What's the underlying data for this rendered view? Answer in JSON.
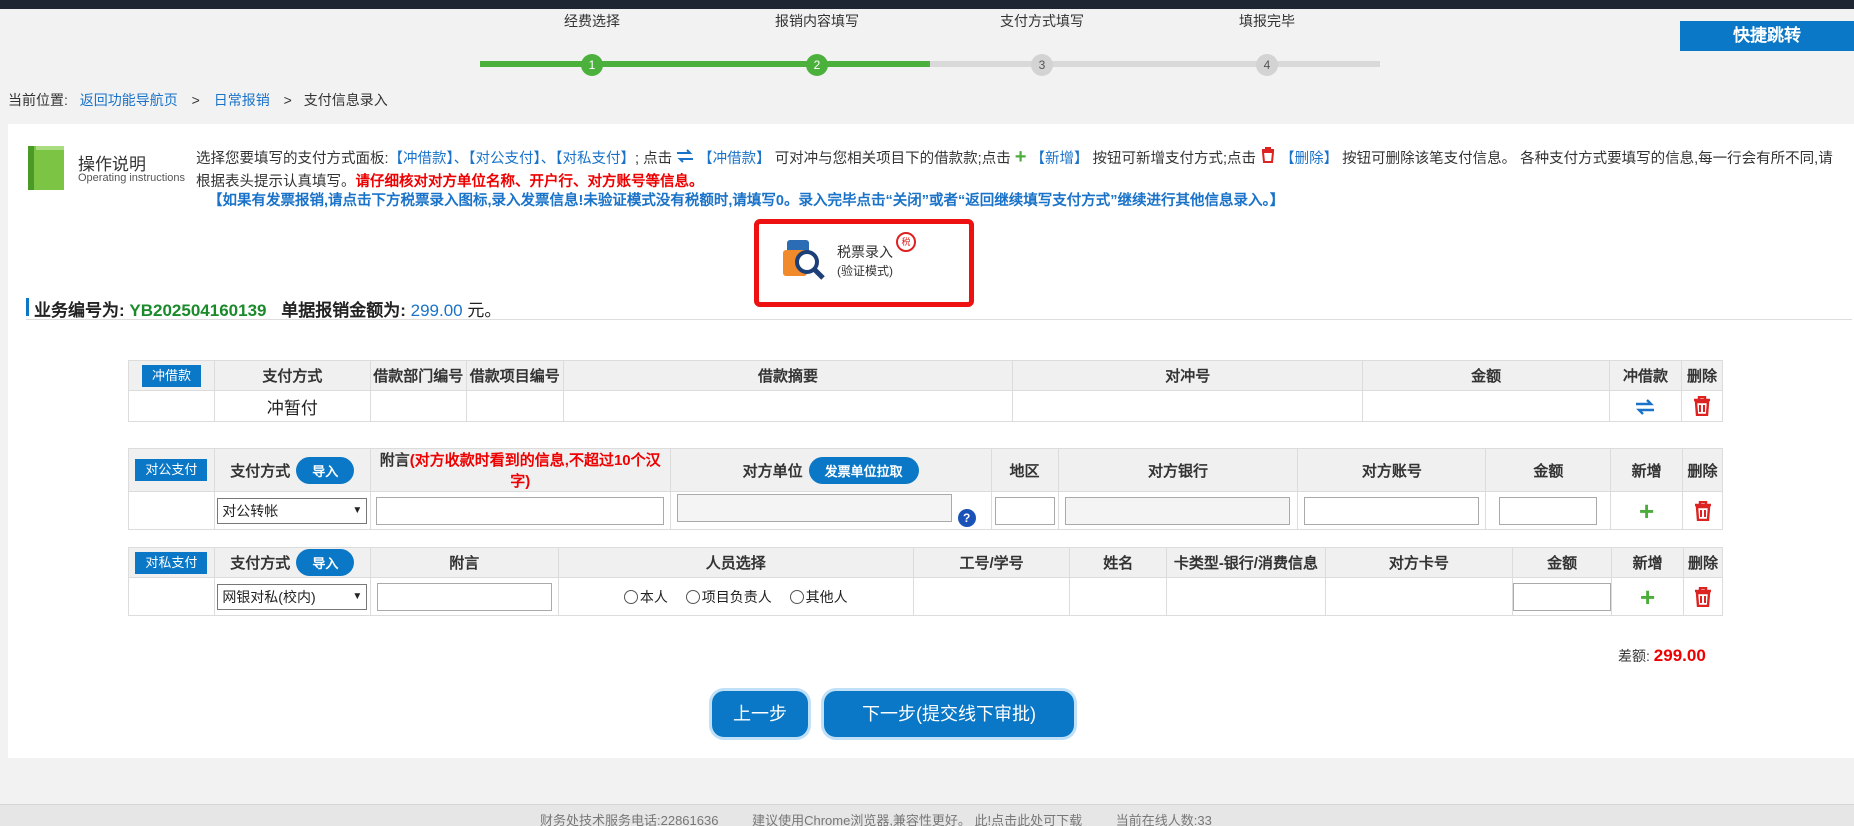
{
  "steps": [
    "经费选择",
    "报销内容填写",
    "支付方式填写",
    "填报完毕"
  ],
  "step_numbers": [
    "1",
    "2",
    "3",
    "4"
  ],
  "quick_jump": "快捷跳转",
  "breadcrumb": {
    "prefix": "当前位置:",
    "home": "返回功能导航页",
    "daily": "日常报销",
    "sep": ">",
    "current": "支付信息录入"
  },
  "instructions": {
    "title": "操作说明",
    "subtitle": "Operating instructions",
    "p1": "选择您要填写的支付方式面板:",
    "p1_links": "【冲借款】、【对公支付】、【对私支付】",
    "p1_b": "; 点击",
    "p1_c": "【冲借款】",
    "p1_d": "可对冲与您相关项目下的借款款;点击",
    "p1_e": "【新增】",
    "p1_f": "按钮可新增支付方式;点击",
    "p1_g": "【删除】",
    "p1_h": "按钮可删除该笔支付信息。 各种支付方式要填写的信息,每一行会有所不同,请根据表头提示认真填写。",
    "p1_red": "请仔细核对对方单位名称、开户行、对方账号等信息。",
    "p2": "【如果有发票报销,请点击下方税票录入图标,录入发票信息!未验证模式没有税额时,请填写0。录入完毕点击“关闭”或者“返回继续填写支付方式”继续进行其他信息录入。】"
  },
  "tax": {
    "title": "税票录入",
    "subtitle": "(验证模式)",
    "badge": "税"
  },
  "business": {
    "label": "业务编号为:",
    "number": "YB202504160139",
    "amount_label": "单据报销金额为:",
    "amount": "299.00",
    "unit": "元。"
  },
  "loan_table": {
    "tag": "冲借款",
    "headers": [
      "支付方式",
      "借款部门编号",
      "借款项目编号",
      "借款摘要",
      "对冲号",
      "金额",
      "冲借款",
      "删除"
    ],
    "row": {
      "method": "冲暂付"
    }
  },
  "public_table": {
    "tag": "对公支付",
    "method_header": "支付方式",
    "import": "导入",
    "note_header": "附言",
    "note_hint": "(对方收款时看到的信息,不超过10个汉字)",
    "party_header": "对方单位",
    "party_pull": "发票单位拉取",
    "headers": [
      "地区",
      "对方银行",
      "对方账号",
      "金额",
      "新增",
      "删除"
    ],
    "row": {
      "method": "对公转帐"
    }
  },
  "private_table": {
    "tag": "对私支付",
    "method_header": "支付方式",
    "import": "导入",
    "headers": [
      "附言",
      "人员选择",
      "工号/学号",
      "姓名",
      "卡类型-银行/消费信息",
      "对方卡号",
      "金额",
      "新增",
      "删除"
    ],
    "row": {
      "method": "网银对私(校内)",
      "radios": [
        "本人",
        "项目负责人",
        "其他人"
      ]
    }
  },
  "diff": {
    "label": "差额:",
    "value": "299.00"
  },
  "buttons": {
    "prev": "上一步",
    "next": "下一步(提交线下审批)"
  },
  "footer": [
    "财务处技术服务电话:22861636",
    "建议使用Chrome浏览器,兼容性更好。 此!点击此处可下载",
    "当前在线人数:33"
  ],
  "colors": {
    "primary": "#0a78c6",
    "success": "#4cb13c",
    "danger": "#e00000"
  }
}
